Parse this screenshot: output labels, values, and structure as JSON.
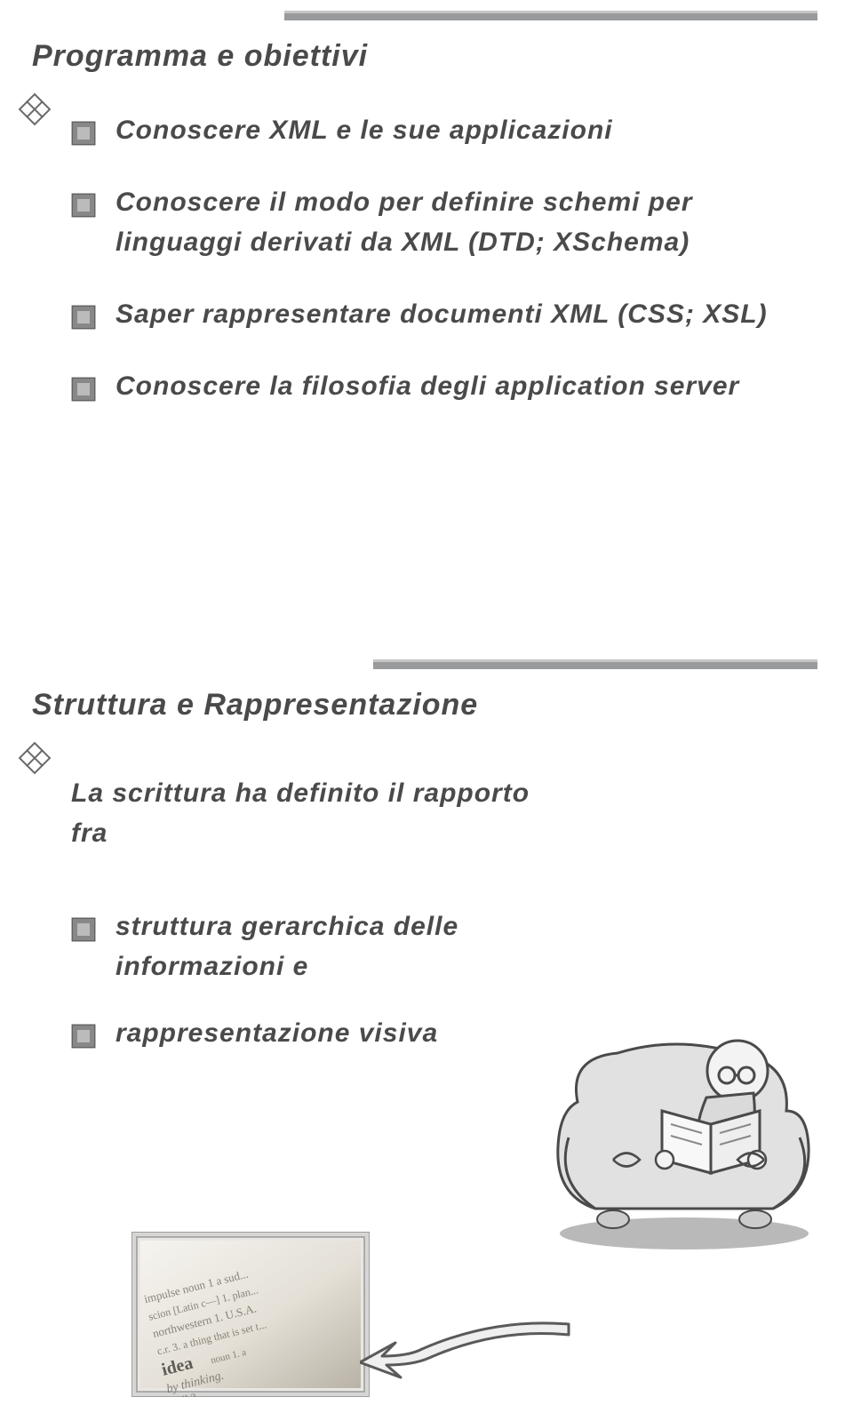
{
  "slide1": {
    "title": "Programma e obiettivi",
    "bullets": [
      "Conoscere XML e le sue applicazioni",
      "Conoscere il modo per definire schemi per linguaggi derivati da XML (DTD; XSchema)",
      "Saper rappresentare documenti XML (CSS; XSL)",
      "Conoscere la filosofia degli application server"
    ]
  },
  "slide2": {
    "title": "Struttura e Rappresentazione",
    "intro": "La scrittura ha definito il rapporto fra",
    "bullets": [
      "struttura gerarchica delle informazioni e",
      "rappresentazione visiva"
    ]
  }
}
